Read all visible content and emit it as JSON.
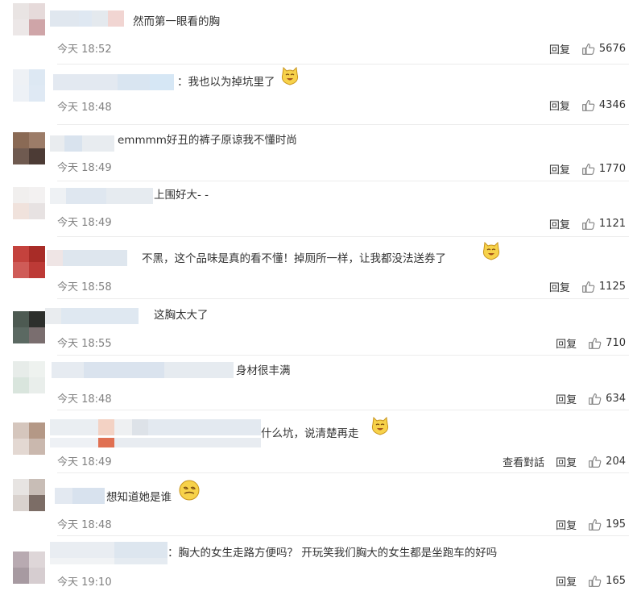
{
  "ui": {
    "reply_label": "回复",
    "view_conversation_label": "查看對話",
    "thumbs_up_icon": "thumbs-up-icon",
    "smile_emoji_icon": "laughing-face-emoji",
    "dizzy_emoji_icon": "dizzy-face-emoji"
  },
  "comments": [
    {
      "text": "然而第一眼看的胸",
      "time": "今天 18:52",
      "likes": "5676"
    },
    {
      "text": "：我也以为掉坑里了",
      "time": "今天 18:48",
      "likes": "4346"
    },
    {
      "text": "emmmm好丑的裤子原谅我不懂时尚",
      "time": "今天 18:49",
      "likes": "1770"
    },
    {
      "text": "上围好大- -",
      "time": "今天 18:49",
      "likes": "1121"
    },
    {
      "text": "不黑，这个品味是真的看不懂！掉厕所一样，让我都没法送券了",
      "time": "今天 18:58",
      "likes": "1125"
    },
    {
      "text": "这胸太大了",
      "time": "今天 18:55",
      "likes": "710"
    },
    {
      "text": "身材很丰满",
      "time": "今天 18:48",
      "likes": "634"
    },
    {
      "text": "什么坑，说清楚再走",
      "time": "今天 18:49",
      "likes": "204"
    },
    {
      "text": "想知道她是谁",
      "time": "今天 18:48",
      "likes": "195"
    },
    {
      "text": "：胸大的女生走路方便吗？ 开玩笑我们胸大的女生都是坐跑车的好吗",
      "time": "今天 19:10",
      "likes": "165"
    }
  ]
}
